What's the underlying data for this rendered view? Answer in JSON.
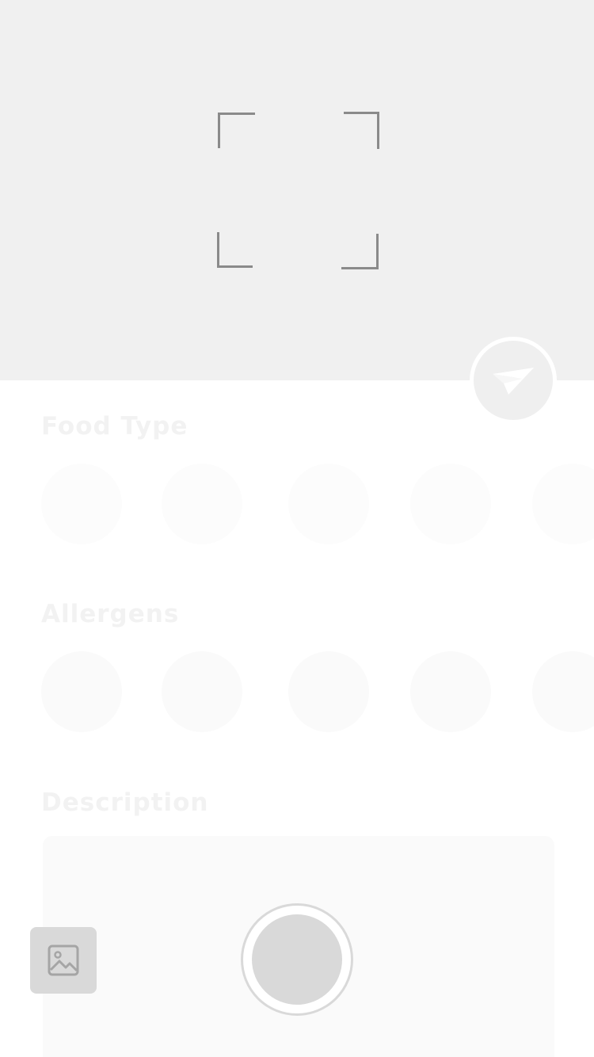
{
  "colors": {
    "preview_background": "#f0f0f0",
    "scan_corner": "#8a8a8a",
    "control_gray": "#d9d9d9",
    "placeholder_circle": "#fafafa"
  },
  "camera": {
    "scan_frame_icon": "scan-frame-corners",
    "send_icon": "paper-plane-icon"
  },
  "sections": {
    "food_type": {
      "label": "Food Type",
      "options_icon": "placeholder-circle"
    },
    "allergens": {
      "label": "Allergens",
      "options_icon": "placeholder-circle"
    },
    "description": {
      "label": "Description",
      "value": ""
    }
  },
  "controls": {
    "gallery_icon": "image-icon",
    "shutter_icon": "shutter-circle"
  }
}
